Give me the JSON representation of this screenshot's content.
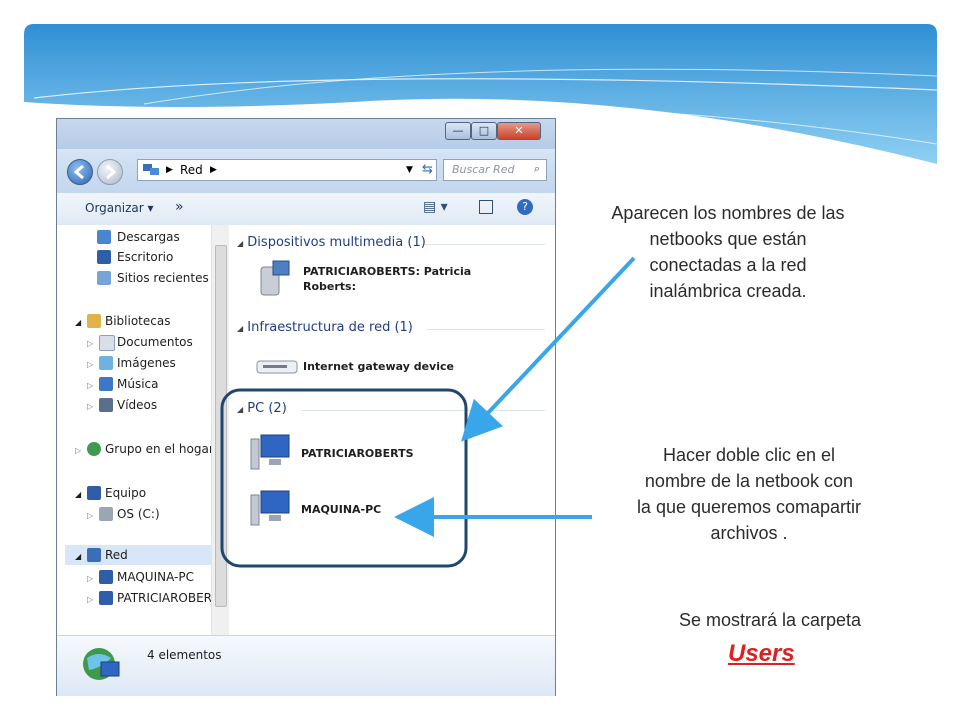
{
  "explorer": {
    "window_buttons": {
      "minimize": "—",
      "maximize": "□",
      "close": "✕"
    },
    "address": {
      "root_label": "Red",
      "search_placeholder": "Buscar Red"
    },
    "toolbar": {
      "organize_label": "Organizar ▾",
      "more_label": "»"
    },
    "nav": {
      "items": [
        {
          "label": "Descargas",
          "icon": "downloads-icon"
        },
        {
          "label": "Escritorio",
          "icon": "desktop-icon"
        },
        {
          "label": "Sitios recientes",
          "icon": "recent-places-icon"
        },
        {
          "label": "Bibliotecas",
          "icon": "libraries-icon"
        },
        {
          "label": "Documentos",
          "icon": "documents-icon"
        },
        {
          "label": "Imágenes",
          "icon": "pictures-icon"
        },
        {
          "label": "Música",
          "icon": "music-icon"
        },
        {
          "label": "Vídeos",
          "icon": "videos-icon"
        },
        {
          "label": "Grupo en el hogar",
          "icon": "homegroup-icon"
        },
        {
          "label": "Equipo",
          "icon": "computer-icon"
        },
        {
          "label": "OS (C:)",
          "icon": "drive-icon"
        },
        {
          "label": "Red",
          "icon": "network-icon"
        },
        {
          "label": "MAQUINA-PC",
          "icon": "pc-icon"
        },
        {
          "label": "PATRICIAROBERT",
          "icon": "pc-icon"
        }
      ]
    },
    "groups": {
      "multimedia": {
        "title": "Dispositivos multimedia (1)",
        "item_line1": "PATRICIAROBERTS: Patricia",
        "item_line2": "Roberts:"
      },
      "infra": {
        "title": "Infraestructura de red (1)",
        "item": "Internet gateway device"
      },
      "pc": {
        "title": "PC (2)",
        "items": [
          "PATRICIAROBERTS",
          "MAQUINA-PC"
        ]
      }
    },
    "status": {
      "count_label": "4 elementos"
    }
  },
  "annotations": {
    "note1": [
      "Aparecen los nombres de las",
      "netbooks que están",
      "conectadas a la red",
      "inalámbrica creada."
    ],
    "note2": [
      "Hacer doble clic en el",
      "nombre de la netbook  con",
      "la que queremos comapartir",
      "archivos ."
    ],
    "note3": "Se mostrará la carpeta",
    "users": "Users"
  },
  "colors": {
    "banner": "#4aa7e0",
    "arrow": "#3aa6ea",
    "highlight_box": "#20466e",
    "users_text": "#e02020"
  }
}
